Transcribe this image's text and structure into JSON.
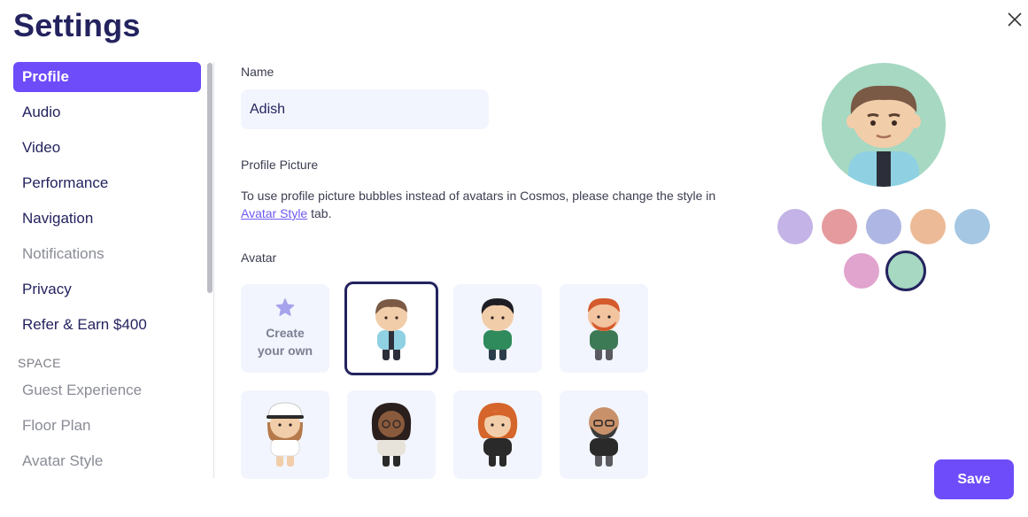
{
  "title": "Settings",
  "sidebar": {
    "items": [
      {
        "label": "Profile"
      },
      {
        "label": "Audio"
      },
      {
        "label": "Video"
      },
      {
        "label": "Performance"
      },
      {
        "label": "Navigation"
      },
      {
        "label": "Notifications"
      },
      {
        "label": "Privacy"
      },
      {
        "label": "Refer & Earn $400"
      }
    ],
    "section_label": "SPACE",
    "space_items": [
      {
        "label": "Guest Experience"
      },
      {
        "label": "Floor Plan"
      },
      {
        "label": "Avatar Style"
      }
    ]
  },
  "profile": {
    "name_label": "Name",
    "name_value": "Adish",
    "picture_label": "Profile Picture",
    "picture_desc_before": "To use profile picture bubbles instead of avatars in Cosmos, please change the style in ",
    "picture_desc_link": "Avatar Style",
    "picture_desc_after": " tab.",
    "avatar_label": "Avatar",
    "create_own_line1": "Create",
    "create_own_line2": "your own"
  },
  "colors": {
    "accent": "#6e4cf9",
    "navy": "#24235f",
    "swatches": [
      "#c4b3e6",
      "#e59a9e",
      "#aeb6e3",
      "#ecba96",
      "#a5c7e3",
      "#e0a4ce",
      "#a6d8c2"
    ]
  },
  "save_label": "Save"
}
